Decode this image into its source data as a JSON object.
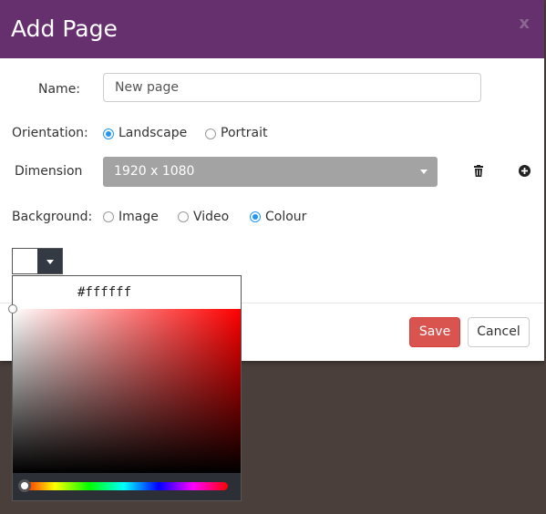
{
  "dialog": {
    "title": "Add Page",
    "close_label": "x"
  },
  "form": {
    "name": {
      "label": "Name:",
      "value": "New page"
    },
    "orientation": {
      "label": "Orientation:",
      "options": [
        "Landscape",
        "Portrait"
      ],
      "selected": "Landscape"
    },
    "dimension": {
      "label": "Dimension",
      "value": "1920 x 1080",
      "delete_icon": "trash-icon",
      "add_icon": "plus-circle-icon"
    },
    "background": {
      "label": "Background:",
      "options": [
        "Image",
        "Video",
        "Colour"
      ],
      "selected": "Colour"
    }
  },
  "color_picker": {
    "hex": "#ffffff",
    "current_color": "#ffffff"
  },
  "footer": {
    "save_label": "Save",
    "cancel_label": "Cancel"
  },
  "colors": {
    "header": "#66306f",
    "save": "#d9534f",
    "radio_accent": "#2196f3",
    "select_bg": "#a3a3a3",
    "backdrop": "#4a3f3b"
  }
}
